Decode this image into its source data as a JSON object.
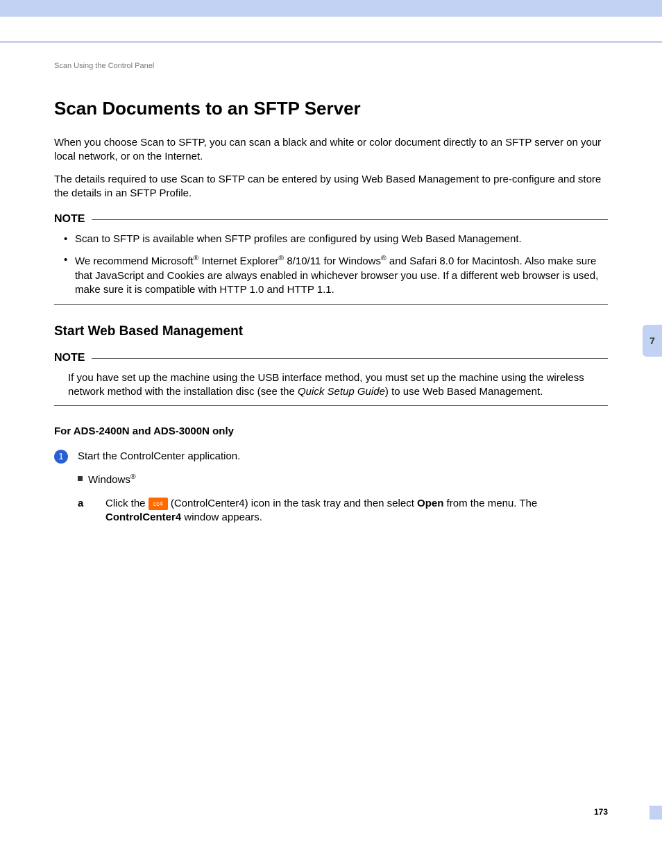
{
  "breadcrumb": "Scan Using the Control Panel",
  "title": "Scan Documents to an SFTP Server",
  "para1": "When you choose Scan to SFTP, you can scan a black and white or color document directly to an SFTP server on your local network, or on the Internet.",
  "para2": "The details required to use Scan to SFTP can be entered by using Web Based Management to pre-configure and store the details in an SFTP Profile.",
  "note_label": "NOTE",
  "note1_bullet1": "Scan to SFTP is available when SFTP profiles are configured by using Web Based Management.",
  "note1_bullet2_a": "We recommend Microsoft",
  "note1_bullet2_b": " Internet Explorer",
  "note1_bullet2_c": " 8/10/11 for Windows",
  "note1_bullet2_d": " and Safari 8.0 for Macintosh. Also make sure that JavaScript and Cookies are always enabled in whichever browser you use. If a different web browser is used, make sure it is compatible with HTTP 1.0 and HTTP 1.1.",
  "section2_title": "Start Web Based Management",
  "note2_a": "If you have set up the machine using the USB interface method, you must set up the machine using the wireless network method with the installation disc (see the ",
  "note2_italic": "Quick Setup Guide",
  "note2_b": ") to use Web Based Management.",
  "models_heading": "For ADS-2400N and ADS-3000N only",
  "step1_num": "1",
  "step1_text": "Start the ControlCenter application.",
  "sub_bullet_a": "Windows",
  "letter_a": "a",
  "step_a_1": "Click the ",
  "cc_icon_text": "cc4",
  "step_a_2": " (ControlCenter4) icon in the task tray and then select ",
  "step_a_open": "Open",
  "step_a_3": " from the menu. The ",
  "step_a_cc4": "ControlCenter4",
  "step_a_4": " window appears.",
  "chapter_tab": "7",
  "page_number": "173"
}
